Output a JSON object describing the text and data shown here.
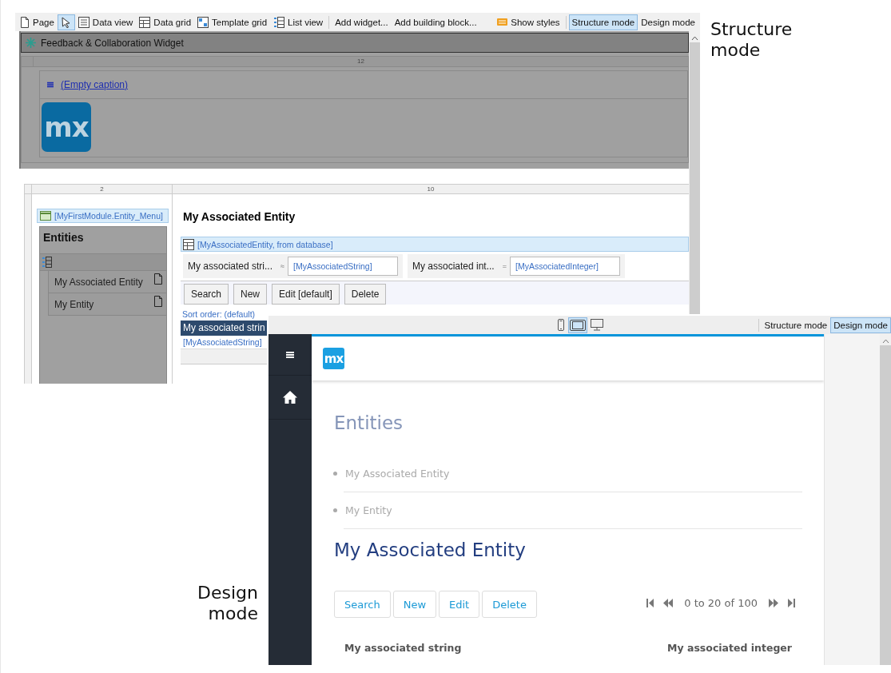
{
  "captions": [
    {
      "kind": "structure",
      "text": "Structure mode"
    },
    {
      "kind": "design",
      "text": "Design mode"
    }
  ],
  "structure_window": {
    "toolbar": {
      "groups": [
        [
          {
            "kind": "page",
            "label": "Page",
            "selected": false
          },
          {
            "kind": "pointer",
            "selected": true
          },
          {
            "kind": "data_view",
            "label": "Data view",
            "selected": false
          },
          {
            "kind": "data_grid",
            "label": "Data grid",
            "selected": false
          },
          {
            "kind": "template_grid",
            "label": "Template grid",
            "selected": false
          },
          {
            "kind": "list_view",
            "label": "List view",
            "selected": false
          }
        ],
        [
          {
            "kind": "text",
            "label": "Add widget...",
            "selected": false
          },
          {
            "kind": "text",
            "label": "Add building block...",
            "selected": false
          }
        ]
      ],
      "show_styles": "Show styles",
      "modes": [
        {
          "label": "Structure mode",
          "selected": true
        },
        {
          "label": "Design mode",
          "selected": false
        }
      ]
    },
    "widget_bar": {
      "title": "Feedback & Collaboration Widget"
    },
    "top_grid": {
      "column_header": "12",
      "caption_link": "(Empty caption)",
      "logo_text": "mx"
    },
    "layout_grid": {
      "columns": [
        "2",
        "10"
      ]
    },
    "menu_widget": {
      "label": "[MyFirstModule.Entity_Menu]",
      "title": "Entities",
      "items": [
        "My Associated Entity",
        "My Entity"
      ]
    },
    "page_title": "My Associated Entity",
    "data_grid": {
      "source": "[MyAssociatedEntity, from database]",
      "search_fields": [
        {
          "label": "My associated stri...",
          "operator": "≈",
          "value": "[MyAssociatedString]"
        },
        {
          "label": "My associated int...",
          "operator": "=",
          "value": "[MyAssociatedInteger]"
        }
      ],
      "buttons": [
        "Search",
        "New",
        "Edit [default]",
        "Delete"
      ],
      "sort_order": "Sort order: (default)",
      "header": "My associated strin",
      "cell": "[MyAssociatedString]"
    }
  },
  "design_window": {
    "devices": [
      {
        "kind": "phone",
        "selected": false
      },
      {
        "kind": "tablet",
        "selected": true
      },
      {
        "kind": "desktop",
        "selected": false
      }
    ],
    "modes": [
      {
        "label": "Structure mode",
        "selected": false
      },
      {
        "label": "Design mode",
        "selected": true
      }
    ],
    "logo_text": "mx",
    "menu_title": "Entities",
    "menu_items": [
      "My Associated Entity",
      "My Entity"
    ],
    "page_title": "My Associated Entity",
    "buttons": [
      "Search",
      "New",
      "Edit",
      "Delete"
    ],
    "pager": "0 to 20 of 100",
    "columns": [
      "My associated string",
      "My associated integer"
    ]
  }
}
